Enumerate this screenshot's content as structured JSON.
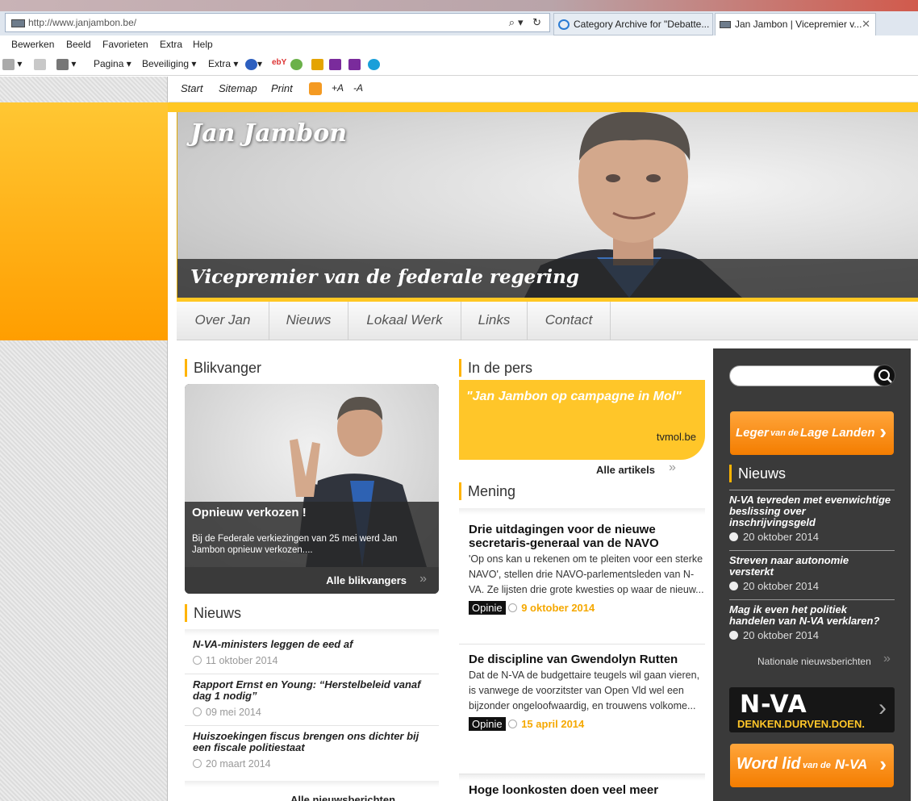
{
  "browser": {
    "url": "http://www.janjambon.be/",
    "tabs": [
      {
        "label": "Category Archive for \"Debatte..."
      },
      {
        "label": "Jan Jambon | Vicepremier v..."
      }
    ],
    "menu": [
      "Bewerken",
      "Beeld",
      "Favorieten",
      "Extra",
      "Help"
    ],
    "commands": {
      "page": "Pagina",
      "security": "Beveiliging",
      "extra": "Extra"
    }
  },
  "topnav": {
    "start": "Start",
    "sitemap": "Sitemap",
    "print": "Print",
    "font_up": "+A",
    "font_down": "-A"
  },
  "hero": {
    "name": "Jan Jambon",
    "tagline": "Vicepremier van de federale regering"
  },
  "mainnav": [
    "Over Jan",
    "Nieuws",
    "Lokaal Werk",
    "Links",
    "Contact"
  ],
  "blikvanger": {
    "heading": "Blikvanger",
    "title": "Opnieuw verkozen !",
    "text": "Bij de Federale verkiezingen van 25 mei werd Jan Jambon opnieuw verkozen....",
    "all_label": "Alle blikvangers"
  },
  "nieuws": {
    "heading": "Nieuws",
    "items": [
      {
        "title": "N-VA-ministers leggen de eed af",
        "date": "11 oktober 2014"
      },
      {
        "title": "Rapport Ernst en Young: “Herstelbeleid vanaf dag 1 nodig”",
        "date": "09 mei 2014"
      },
      {
        "title": "Huiszoekingen fiscus brengen ons dichter bij een fiscale politiestaat",
        "date": "20 maart 2014"
      }
    ],
    "all_label": "Alle nieuwsberichten"
  },
  "pers": {
    "heading": "In de pers",
    "quote": "\"Jan Jambon op campagne in Mol\"",
    "source": "tvmol.be",
    "all_label": "Alle artikels"
  },
  "mening": {
    "heading": "Mening",
    "items": [
      {
        "title": "Drie uitdagingen voor de nieuwe secretaris-generaal van de NAVO",
        "text": "'Op ons kan u rekenen om te pleiten voor een sterke NAVO', stellen drie NAVO-parlementsleden van N-VA. Ze lijsten drie grote kwesties op waar de nieuw...",
        "tag": "Opinie",
        "date": "9 oktober 2014"
      },
      {
        "title": "De discipline van Gwendolyn Rutten",
        "text": "Dat de N-VA de budgettaire teugels wil gaan vieren, is vanwege de voorzitster van Open Vld wel een bijzonder ongeloofwaardig, en trouwens volkome...",
        "tag": "Opinie",
        "date": "15 april 2014"
      },
      {
        "title": "Hoge loonkosten doen veel meer"
      }
    ]
  },
  "sidebar": {
    "leger": {
      "part1": "Leger",
      "part2": "van de",
      "part3": "Lage Landen"
    },
    "news_heading": "Nieuws",
    "news": [
      {
        "title": "N-VA tevreden met evenwichtige beslissing over inschrijvingsgeld",
        "date": "20 oktober 2014"
      },
      {
        "title": "Streven naar autonomie versterkt",
        "date": "20 oktober 2014"
      },
      {
        "title": "Mag ik even het politiek handelen van N-VA verklaren?",
        "date": "20 oktober 2014"
      }
    ],
    "national_label": "Nationale nieuwsberichten",
    "nva_logo": "N-VA",
    "nva_slogan": "DENKEN.DURVEN.DOEN.",
    "word_lid": {
      "part1": "Word lid",
      "part2": "van de",
      "part3": "N-VA"
    }
  },
  "colors": {
    "accent": "#ffc629",
    "orange": "#f47d00",
    "dark": "#3a3a3a"
  }
}
